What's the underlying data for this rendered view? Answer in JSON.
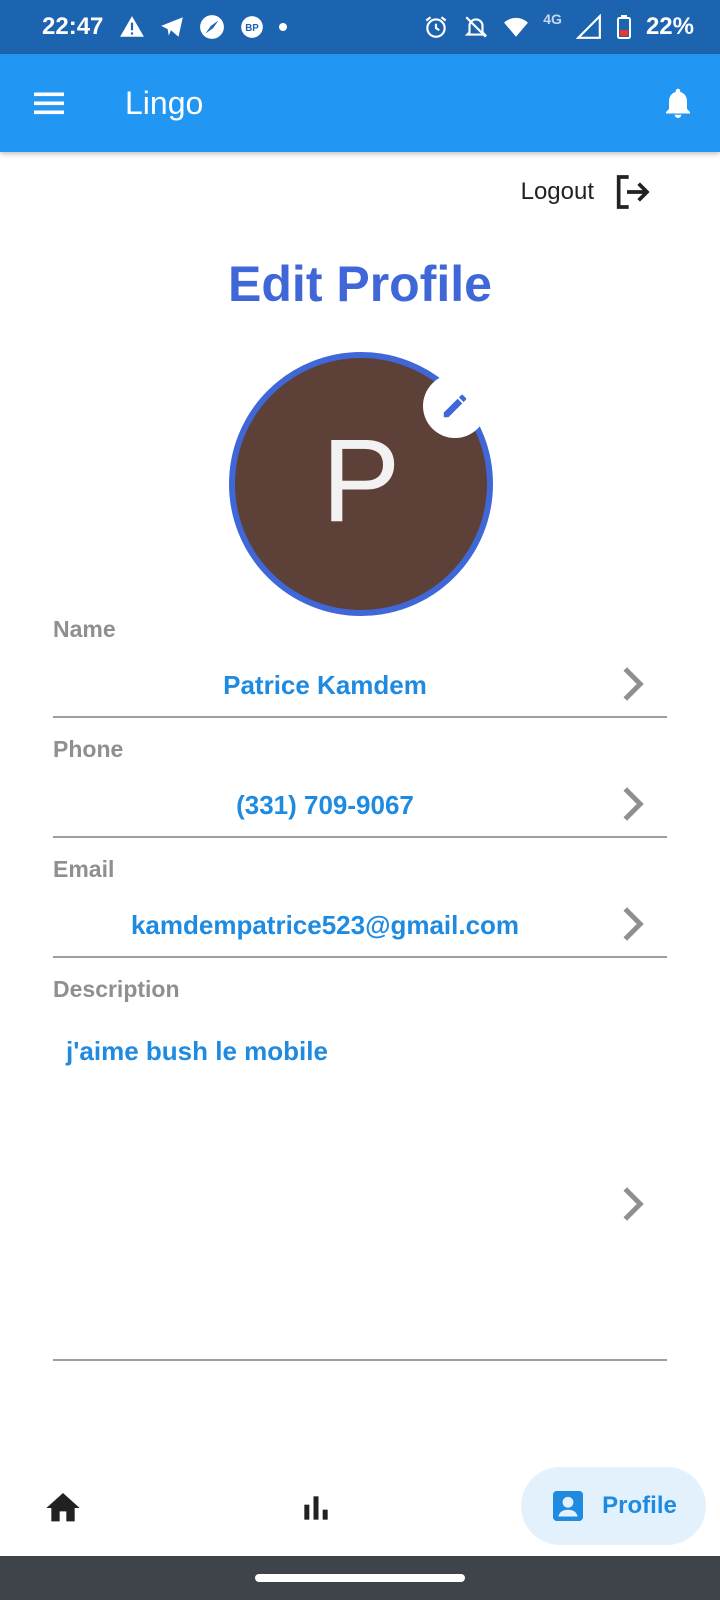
{
  "status_bar": {
    "time": "22:47",
    "network": "4G",
    "battery": "22%",
    "icons_left": [
      "warning-icon",
      "telegram-icon",
      "compass-icon",
      "bp-icon",
      "dot"
    ],
    "icons_right": [
      "alarm-icon",
      "notifications-off-icon",
      "wifi-icon",
      "signal-icon",
      "battery-icon"
    ]
  },
  "app_bar": {
    "title": "Lingo",
    "color": "#2196f3"
  },
  "logout": {
    "label": "Logout"
  },
  "page": {
    "title": "Edit Profile"
  },
  "avatar": {
    "initial": "P",
    "background": "#5d4037",
    "ring": "#3f67d8"
  },
  "fields": {
    "name": {
      "label": "Name",
      "value": "Patrice Kamdem"
    },
    "phone": {
      "label": "Phone",
      "value": "(331) 709-9067"
    },
    "email": {
      "label": "Email",
      "value": "kamdempatrice523@gmail.com"
    },
    "description": {
      "label": "Description",
      "value": "j'aime bush le mobile"
    }
  },
  "bottom_nav": {
    "items": [
      {
        "name": "home",
        "icon": "home-icon"
      },
      {
        "name": "stats",
        "icon": "bar-chart-icon"
      },
      {
        "name": "profile",
        "icon": "profile-icon",
        "label": "Profile",
        "selected": true
      }
    ]
  },
  "colors": {
    "accent": "#1e8ae0",
    "title": "#3f67d8",
    "label": "#8f8f8f"
  }
}
